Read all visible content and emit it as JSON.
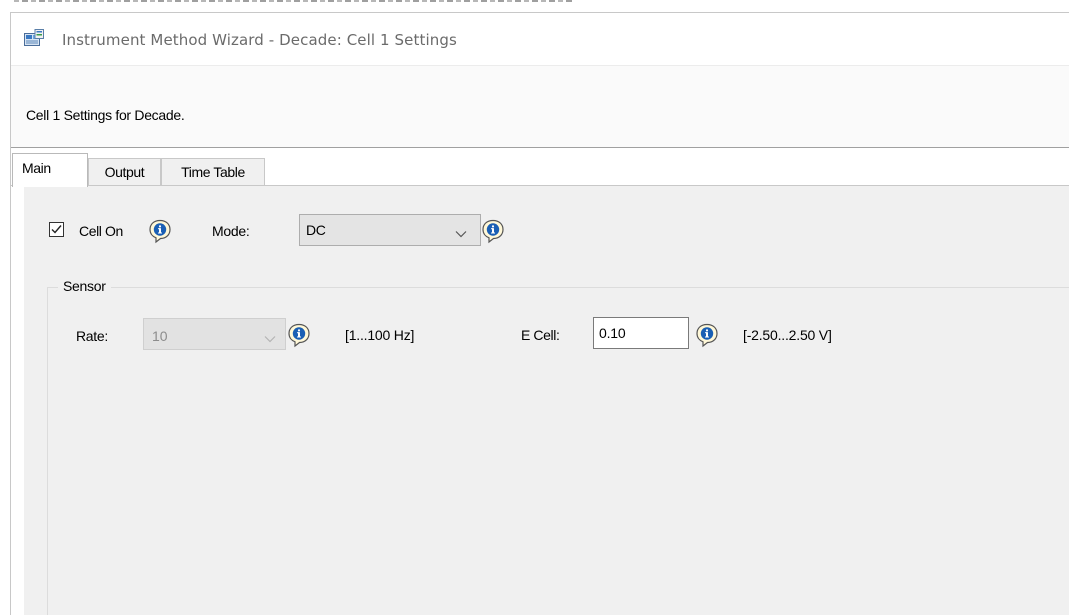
{
  "window": {
    "title": "Instrument Method Wizard - Decade: Cell 1 Settings",
    "app_icon": "instrument-method-wizard-icon"
  },
  "header": {
    "text": "Cell 1 Settings for Decade."
  },
  "tabs": [
    {
      "label": "Main",
      "selected": true
    },
    {
      "label": "Output",
      "selected": false
    },
    {
      "label": "Time Table",
      "selected": false
    }
  ],
  "main": {
    "cell_on": {
      "label": "Cell On",
      "checked": true,
      "info_icon": "info-icon"
    },
    "mode": {
      "label": "Mode:",
      "value": "DC",
      "info_icon": "info-icon"
    },
    "sensor": {
      "group_label": "Sensor",
      "rate": {
        "label": "Rate:",
        "value": "10",
        "enabled": false,
        "range": "[1...100 Hz]",
        "info_icon": "info-icon"
      },
      "ecell": {
        "label": "E Cell:",
        "value": "0.10",
        "range": "[-2.50...2.50 V]",
        "info_icon": "info-icon"
      }
    }
  },
  "colors": {
    "panel_bg": "#f0f0f0",
    "info_icon_blue": "#1a5fb4",
    "title_text": "#6b6b6b"
  }
}
